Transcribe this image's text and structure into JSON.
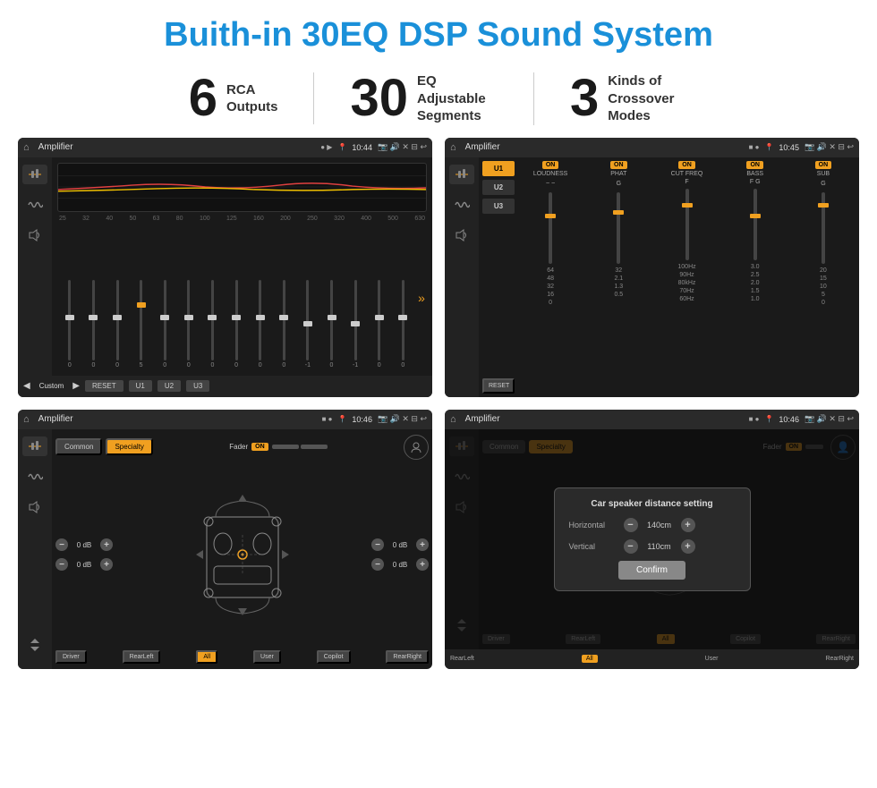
{
  "header": {
    "title": "Buith-in 30EQ DSP Sound System"
  },
  "stats": [
    {
      "number": "6",
      "label": "RCA\nOutputs"
    },
    {
      "number": "30",
      "label": "EQ Adjustable\nSegments"
    },
    {
      "number": "3",
      "label": "Kinds of\nCrossover Modes"
    }
  ],
  "screens": [
    {
      "id": "screen1",
      "app_title": "Amplifier",
      "time": "10:44",
      "type": "eq"
    },
    {
      "id": "screen2",
      "app_title": "Amplifier",
      "time": "10:45",
      "type": "crossover"
    },
    {
      "id": "screen3",
      "app_title": "Amplifier",
      "time": "10:46",
      "type": "fader"
    },
    {
      "id": "screen4",
      "app_title": "Amplifier",
      "time": "10:46",
      "type": "dialog"
    }
  ],
  "eq": {
    "frequencies": [
      "25",
      "32",
      "40",
      "50",
      "63",
      "80",
      "100",
      "125",
      "160",
      "200",
      "250",
      "320",
      "400",
      "500",
      "630"
    ],
    "values": [
      "0",
      "0",
      "0",
      "5",
      "0",
      "0",
      "0",
      "0",
      "0",
      "0",
      "-1",
      "0",
      "-1"
    ],
    "presets": [
      "Custom",
      "RESET",
      "U1",
      "U2",
      "U3"
    ]
  },
  "crossover": {
    "presets": [
      "U1",
      "U2",
      "U3"
    ],
    "channels": [
      {
        "label": "LOUDNESS",
        "on": true
      },
      {
        "label": "PHAT",
        "on": true
      },
      {
        "label": "CUT FREQ",
        "on": true
      },
      {
        "label": "BASS",
        "on": true
      },
      {
        "label": "SUB",
        "on": true
      }
    ]
  },
  "fader": {
    "tabs": [
      "Common",
      "Specialty"
    ],
    "active_tab": "Specialty",
    "fader_label": "Fader",
    "fader_on": "ON",
    "positions": [
      "Driver",
      "RearLeft",
      "All",
      "Copilot",
      "RearRight"
    ],
    "active_position": "All",
    "volumes": [
      "0 dB",
      "0 dB",
      "0 dB",
      "0 dB"
    ]
  },
  "dialog": {
    "title": "Car speaker distance setting",
    "horizontal_label": "Horizontal",
    "horizontal_value": "140cm",
    "vertical_label": "Vertical",
    "vertical_value": "110cm",
    "confirm_label": "Confirm"
  }
}
